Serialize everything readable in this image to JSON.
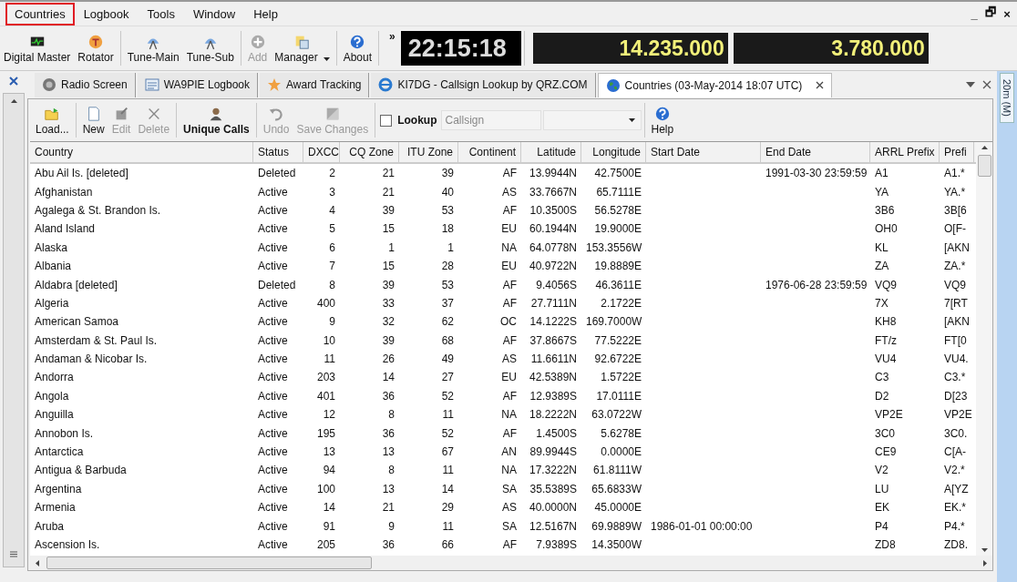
{
  "menu": [
    {
      "label": "Countries",
      "highlighted": true
    },
    {
      "label": "Logbook",
      "highlighted": false
    },
    {
      "label": "Tools",
      "highlighted": false
    },
    {
      "label": "Window",
      "highlighted": false
    },
    {
      "label": "Help",
      "highlighted": false
    }
  ],
  "window_controls": [
    "_",
    "🗗",
    "×"
  ],
  "toolbar": {
    "groups": [
      [
        {
          "label": "Digital Master",
          "disabled": false,
          "dropdown": false
        },
        {
          "label": "Rotator",
          "disabled": false,
          "dropdown": false
        }
      ],
      [
        {
          "label": "Tune-Main",
          "disabled": false,
          "dropdown": false
        },
        {
          "label": "Tune-Sub",
          "disabled": false,
          "dropdown": false
        }
      ],
      [
        {
          "label": "Add",
          "disabled": true,
          "dropdown": false
        },
        {
          "label": "Manager",
          "disabled": false,
          "dropdown": true
        }
      ],
      [
        {
          "label": "About",
          "disabled": false,
          "dropdown": false
        }
      ]
    ],
    "overflow": "»",
    "clock": "22:15:18",
    "frequencies": [
      "14.235.000",
      "3.780.000"
    ]
  },
  "tabs": [
    {
      "label": "Radio Screen",
      "selected": false
    },
    {
      "label": "WA9PIE Logbook",
      "selected": false
    },
    {
      "label": "Award Tracking",
      "selected": false
    },
    {
      "label": "KI7DG - Callsign Lookup by QRZ.COM",
      "selected": false
    },
    {
      "label": "Countries (03-May-2014 18:07 UTC)",
      "selected": true
    }
  ],
  "side_tab": "20m (M)",
  "sub_toolbar": {
    "groups": [
      [
        {
          "label": "Load...",
          "disabled": false
        }
      ],
      [
        {
          "label": "New",
          "disabled": false
        },
        {
          "label": "Edit",
          "disabled": true
        },
        {
          "label": "Delete",
          "disabled": true
        }
      ],
      [
        {
          "label": "Unique Calls",
          "disabled": false
        }
      ],
      [
        {
          "label": "Undo",
          "disabled": true
        },
        {
          "label": "Save Changes",
          "disabled": true
        }
      ]
    ],
    "lookup": {
      "label": "Lookup",
      "checked": false,
      "placeholder": "Callsign"
    },
    "help": "Help"
  },
  "table": {
    "columns": [
      "Country",
      "Status",
      "DXCC",
      "CQ Zone",
      "ITU Zone",
      "Continent",
      "Latitude",
      "Longitude",
      "Start Date",
      "End Date",
      "ARRL Prefix",
      "Prefi"
    ],
    "rows": [
      [
        "Abu Ail Is. [deleted]",
        "Deleted",
        "2",
        "21",
        "39",
        "AF",
        "13.9944N",
        "42.7500E",
        "",
        "1991-03-30 23:59:59",
        "A1",
        "A1.*"
      ],
      [
        "Afghanistan",
        "Active",
        "3",
        "21",
        "40",
        "AS",
        "33.7667N",
        "65.7111E",
        "",
        "",
        "YA",
        "YA.*"
      ],
      [
        "Agalega & St. Brandon Is.",
        "Active",
        "4",
        "39",
        "53",
        "AF",
        "10.3500S",
        "56.5278E",
        "",
        "",
        "3B6",
        "3B[6"
      ],
      [
        "Aland Island",
        "Active",
        "5",
        "15",
        "18",
        "EU",
        "60.1944N",
        "19.9000E",
        "",
        "",
        "OH0",
        "O[F-"
      ],
      [
        "Alaska",
        "Active",
        "6",
        "1",
        "1",
        "NA",
        "64.0778N",
        "153.3556W",
        "",
        "",
        "KL",
        "[AKN"
      ],
      [
        "Albania",
        "Active",
        "7",
        "15",
        "28",
        "EU",
        "40.9722N",
        "19.8889E",
        "",
        "",
        "ZA",
        "ZA.*"
      ],
      [
        "Aldabra [deleted]",
        "Deleted",
        "8",
        "39",
        "53",
        "AF",
        "9.4056S",
        "46.3611E",
        "",
        "1976-06-28 23:59:59",
        "VQ9",
        "VQ9"
      ],
      [
        "Algeria",
        "Active",
        "400",
        "33",
        "37",
        "AF",
        "27.7111N",
        "2.1722E",
        "",
        "",
        "7X",
        "7[RT"
      ],
      [
        "American Samoa",
        "Active",
        "9",
        "32",
        "62",
        "OC",
        "14.1222S",
        "169.7000W",
        "",
        "",
        "KH8",
        "[AKN"
      ],
      [
        "Amsterdam & St. Paul Is.",
        "Active",
        "10",
        "39",
        "68",
        "AF",
        "37.8667S",
        "77.5222E",
        "",
        "",
        "FT/z",
        "FT[0"
      ],
      [
        "Andaman & Nicobar Is.",
        "Active",
        "11",
        "26",
        "49",
        "AS",
        "11.6611N",
        "92.6722E",
        "",
        "",
        "VU4",
        "VU4."
      ],
      [
        "Andorra",
        "Active",
        "203",
        "14",
        "27",
        "EU",
        "42.5389N",
        "1.5722E",
        "",
        "",
        "C3",
        "C3.*"
      ],
      [
        "Angola",
        "Active",
        "401",
        "36",
        "52",
        "AF",
        "12.9389S",
        "17.0111E",
        "",
        "",
        "D2",
        "D[23"
      ],
      [
        "Anguilla",
        "Active",
        "12",
        "8",
        "11",
        "NA",
        "18.2222N",
        "63.0722W",
        "",
        "",
        "VP2E",
        "VP2E"
      ],
      [
        "Annobon Is.",
        "Active",
        "195",
        "36",
        "52",
        "AF",
        "1.4500S",
        "5.6278E",
        "",
        "",
        "3C0",
        "3C0."
      ],
      [
        "Antarctica",
        "Active",
        "13",
        "13",
        "67",
        "AN",
        "89.9944S",
        "0.0000E",
        "",
        "",
        "CE9",
        "C[A-"
      ],
      [
        "Antigua & Barbuda",
        "Active",
        "94",
        "8",
        "11",
        "NA",
        "17.3222N",
        "61.8111W",
        "",
        "",
        "V2",
        "V2.*"
      ],
      [
        "Argentina",
        "Active",
        "100",
        "13",
        "14",
        "SA",
        "35.5389S",
        "65.6833W",
        "",
        "",
        "LU",
        "A[YZ"
      ],
      [
        "Armenia",
        "Active",
        "14",
        "21",
        "29",
        "AS",
        "40.0000N",
        "45.0000E",
        "",
        "",
        "EK",
        "EK.*"
      ],
      [
        "Aruba",
        "Active",
        "91",
        "9",
        "11",
        "SA",
        "12.5167N",
        "69.9889W",
        "1986-01-01 00:00:00",
        "",
        "P4",
        "P4.*"
      ],
      [
        "Ascension Is.",
        "Active",
        "205",
        "36",
        "66",
        "AF",
        "7.9389S",
        "14.3500W",
        "",
        "",
        "ZD8",
        "ZD8."
      ]
    ]
  }
}
